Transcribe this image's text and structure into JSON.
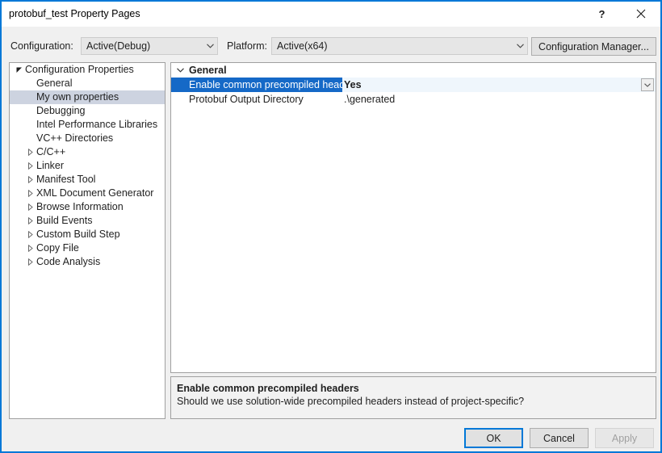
{
  "window": {
    "title": "protobuf_test Property Pages",
    "accent_color": "#0078d7",
    "help_glyph": "?",
    "close_icon": "close-icon"
  },
  "toolbar": {
    "configuration_label": "Configuration:",
    "configuration_value": "Active(Debug)",
    "platform_label": "Platform:",
    "platform_value": "Active(x64)",
    "configuration_manager_label": "Configuration Manager...",
    "dropdown_icon": "chevron-down-icon"
  },
  "tree": {
    "selected_index": 2,
    "items": [
      {
        "label": "Configuration Properties",
        "depth": 0,
        "state": "expanded"
      },
      {
        "label": "General",
        "depth": 1,
        "state": "leaf"
      },
      {
        "label": "My own properties",
        "depth": 1,
        "state": "leaf"
      },
      {
        "label": "Debugging",
        "depth": 1,
        "state": "leaf"
      },
      {
        "label": "Intel Performance Libraries",
        "depth": 1,
        "state": "leaf"
      },
      {
        "label": "VC++ Directories",
        "depth": 1,
        "state": "leaf"
      },
      {
        "label": "C/C++",
        "depth": 1,
        "state": "collapsed"
      },
      {
        "label": "Linker",
        "depth": 1,
        "state": "collapsed"
      },
      {
        "label": "Manifest Tool",
        "depth": 1,
        "state": "collapsed"
      },
      {
        "label": "XML Document Generator",
        "depth": 1,
        "state": "collapsed"
      },
      {
        "label": "Browse Information",
        "depth": 1,
        "state": "collapsed"
      },
      {
        "label": "Build Events",
        "depth": 1,
        "state": "collapsed"
      },
      {
        "label": "Custom Build Step",
        "depth": 1,
        "state": "collapsed"
      },
      {
        "label": "Copy File",
        "depth": 1,
        "state": "collapsed"
      },
      {
        "label": "Code Analysis",
        "depth": 1,
        "state": "collapsed"
      }
    ]
  },
  "grid": {
    "category_label": "General",
    "category_state": "expanded",
    "rows": [
      {
        "name": "Enable common precompiled headers",
        "value": "Yes",
        "selected": true
      },
      {
        "name": "Protobuf Output Directory",
        "value": ".\\generated",
        "selected": false
      }
    ]
  },
  "description": {
    "title": "Enable common precompiled headers",
    "body": "Should we use solution-wide precompiled headers instead of project-specific?"
  },
  "footer": {
    "ok_label": "OK",
    "cancel_label": "Cancel",
    "apply_label": "Apply",
    "apply_enabled": false
  }
}
